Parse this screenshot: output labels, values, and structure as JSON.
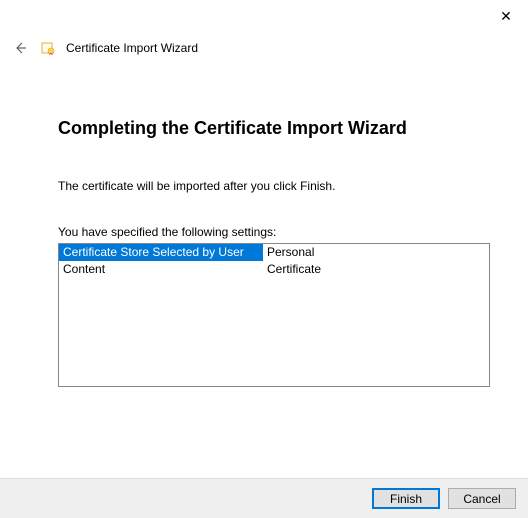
{
  "window": {
    "title": "Certificate Import Wizard"
  },
  "page": {
    "heading": "Completing the Certificate Import Wizard",
    "description": "The certificate will be imported after you click Finish.",
    "settings_label": "You have specified the following settings:"
  },
  "settings": {
    "rows": [
      {
        "label": "Certificate Store Selected by User",
        "value": "Personal",
        "selected": true
      },
      {
        "label": "Content",
        "value": "Certificate",
        "selected": false
      }
    ]
  },
  "buttons": {
    "finish": "Finish",
    "cancel": "Cancel"
  },
  "icons": {
    "close": "✕",
    "back": "←"
  }
}
